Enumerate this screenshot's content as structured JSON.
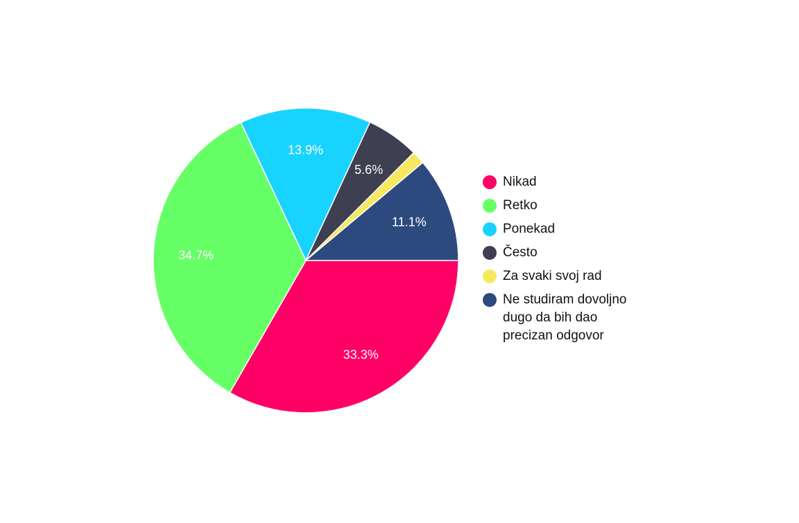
{
  "chart_data": {
    "type": "pie",
    "title": "",
    "start_angle_deg": 0,
    "direction": "clockwise",
    "legend_position": "right",
    "slices": [
      {
        "label": "Nikad",
        "value": 33.3,
        "display": "33.3%",
        "color": "#ff0066",
        "label_color": "#ffffff"
      },
      {
        "label": "Retko",
        "value": 34.7,
        "display": "34.7%",
        "color": "#66ff66",
        "label_color": "#ffffff"
      },
      {
        "label": "Ponekad",
        "value": 13.9,
        "display": "13.9%",
        "color": "#19d3ff",
        "label_color": "#ffffff"
      },
      {
        "label": "Često",
        "value": 5.6,
        "display": "5.6%",
        "color": "#3f3f52",
        "label_color": "#ffffff"
      },
      {
        "label": "Za svaki svoj rad",
        "value": 1.4,
        "display": "",
        "color": "#f5e95f",
        "label_color": "#ffffff"
      },
      {
        "label": "Ne studiram dovoljno dugo da bih dao precizan odgovor",
        "value": 11.1,
        "display": "11.1%",
        "color": "#2d4a7f",
        "label_color": "#ffffff"
      }
    ],
    "legend": [
      {
        "lines": [
          "Nikad"
        ],
        "color": "#ff0066"
      },
      {
        "lines": [
          "Retko"
        ],
        "color": "#66ff66"
      },
      {
        "lines": [
          "Ponekad"
        ],
        "color": "#19d3ff"
      },
      {
        "lines": [
          "Često"
        ],
        "color": "#3f3f52"
      },
      {
        "lines": [
          "Za svaki svoj rad"
        ],
        "color": "#f5e95f"
      },
      {
        "lines": [
          "Ne studiram dovoljno",
          "dugo da bih dao",
          "precizan odgovor"
        ],
        "color": "#2d4a7f"
      }
    ]
  }
}
